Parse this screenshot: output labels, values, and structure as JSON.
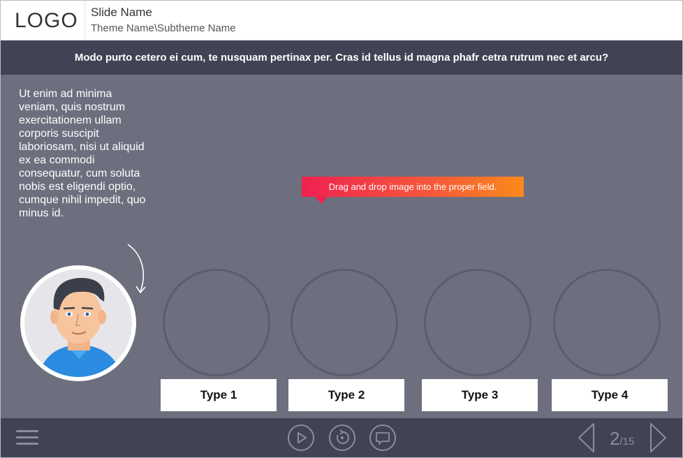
{
  "header": {
    "logo": "LOGO",
    "slide_name": "Slide Name",
    "theme_name": "Theme Name\\Subtheme Name"
  },
  "question": "Modo purto cetero ei cum, te nusquam pertinax per. Cras id tellus id magna phafr cetra rutrum nec et arcu?",
  "body_text": "Ut enim ad minima veniam, quis nostrum exercitationem ullam corporis suscipit laboriosam, nisi ut aliquid ex ea commodi consequatur, cum soluta nobis est eligendi optio, cumque nihil impedit, quo minus id.",
  "tooltip": "Drag and drop image into the proper field.",
  "drop_zones": [
    {
      "label": "Type 1"
    },
    {
      "label": "Type 2"
    },
    {
      "label": "Type 3"
    },
    {
      "label": "Type 4"
    }
  ],
  "footer": {
    "icons": [
      "menu-icon",
      "play-icon",
      "replay-icon",
      "comment-icon",
      "prev-arrow-icon",
      "next-arrow-icon"
    ],
    "page_current": "2",
    "page_total": "/15"
  },
  "colors": {
    "background": "#6d6f7e",
    "bars": "#414355",
    "tooltip_start": "#ee2250",
    "tooltip_end": "#fb8a1a"
  }
}
